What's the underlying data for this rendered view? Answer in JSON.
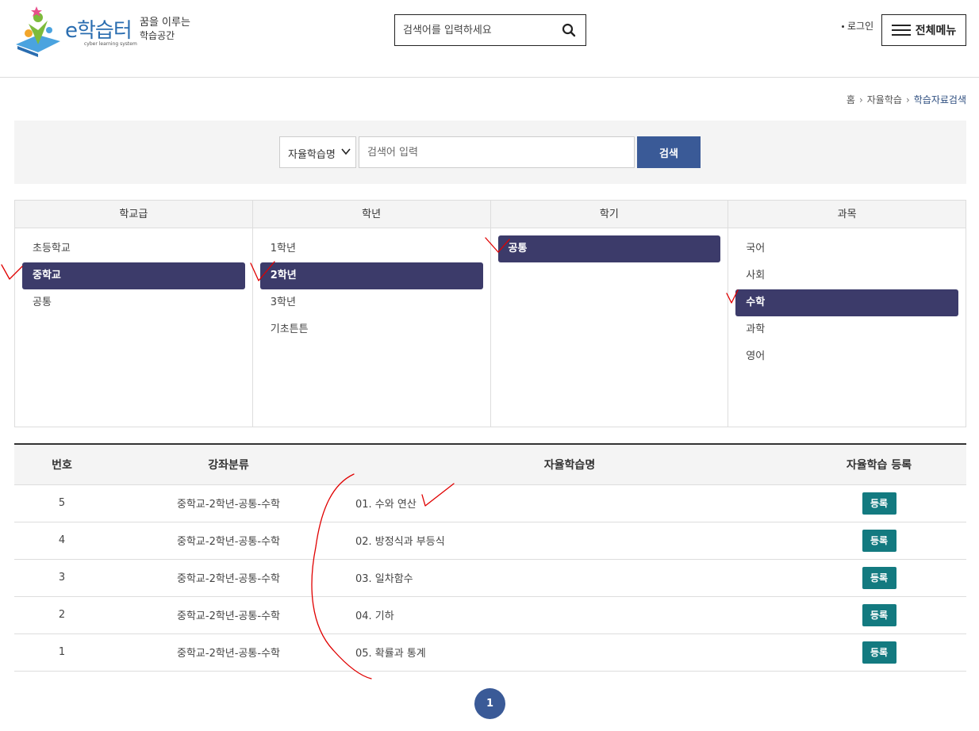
{
  "header": {
    "logo_name": "e학습터",
    "logo_sub": "cyber learning system",
    "slogan_line1": "꿈을 이루는",
    "slogan_line2": "학습공간",
    "search_placeholder": "검색어를 입력하세요",
    "login_label": "로그인",
    "menu_label": "전체메뉴"
  },
  "breadcrumb": {
    "home": "홈",
    "section": "자율학습",
    "current": "학습자료검색"
  },
  "search": {
    "select_value": "자율학습명",
    "input_placeholder": "검색어 입력",
    "button_label": "검색"
  },
  "filters": {
    "school_level": {
      "header": "학교급",
      "items": [
        "초등학교",
        "중학교",
        "공통"
      ]
    },
    "grade": {
      "header": "학년",
      "items": [
        "1학년",
        "2학년",
        "3학년",
        "기초튼튼"
      ]
    },
    "semester": {
      "header": "학기",
      "items": [
        "공통"
      ]
    },
    "subject": {
      "header": "과목",
      "items": [
        "국어",
        "사회",
        "수학",
        "과학",
        "영어"
      ]
    }
  },
  "table": {
    "headers": [
      "번호",
      "강좌분류",
      "자율학습명",
      "자율학습 등록"
    ],
    "rows": [
      {
        "no": "5",
        "category": "중학교-2학년-공통-수학",
        "name": "01. 수와 연산",
        "action": "등록"
      },
      {
        "no": "4",
        "category": "중학교-2학년-공통-수학",
        "name": "02. 방정식과 부등식",
        "action": "등록"
      },
      {
        "no": "3",
        "category": "중학교-2학년-공통-수학",
        "name": "03. 일차함수",
        "action": "등록"
      },
      {
        "no": "2",
        "category": "중학교-2학년-공통-수학",
        "name": "04. 기하",
        "action": "등록"
      },
      {
        "no": "1",
        "category": "중학교-2학년-공통-수학",
        "name": "05. 확률과 통계",
        "action": "등록"
      }
    ]
  },
  "pagination": {
    "current": "1"
  },
  "colors": {
    "primary": "#3a5a97",
    "active_filter": "#3c3b6a",
    "register": "#137a80",
    "annotation": "#e00000"
  },
  "icons": {
    "search": "search-icon",
    "menu": "hamburger-icon",
    "select": "chevron-down-icon"
  }
}
